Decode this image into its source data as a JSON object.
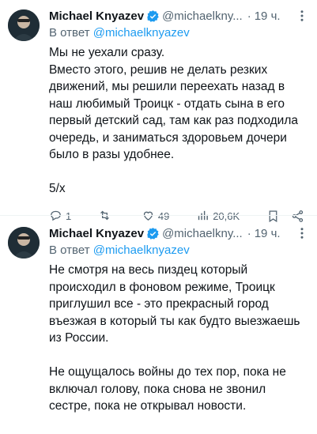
{
  "tweets": [
    {
      "author": "Michael Knyazev",
      "handle": "@michaelkny...",
      "dot": "·",
      "time": "19 ч.",
      "reply_prefix": "В ответ",
      "reply_mention": "@michaelknyazev",
      "paragraphs": [
        "Мы не уехали сразу.\nВместо этого, решив не делать резких движений, мы решили переехать назад в наш любимый Троицк - отдать сына в его первый детский сад, там как раз подходила очередь, и заниматься здоровьем дочери было в разы удобнее.",
        "5/х"
      ],
      "stats": {
        "replies": "1",
        "retweets": "",
        "likes": "49",
        "views": "20,6K"
      }
    },
    {
      "author": "Michael Knyazev",
      "handle": "@michaelkny...",
      "dot": "·",
      "time": "19 ч.",
      "reply_prefix": "В ответ",
      "reply_mention": "@michaelknyazev",
      "paragraphs": [
        "Не смотря на весь пиздец который происходил в фоновом режиме, Троицк приглушил все - это прекрасный город въезжая в который ты как будто выезжаешь из России.",
        "Не ощущалось войны до тех пор, пока не включал голову, пока снова не звонил сестре, пока не открывал новости."
      ]
    }
  ],
  "colors": {
    "accent": "#1d9bf0",
    "muted": "#536471",
    "text": "#0f1419",
    "divider": "#eff3f4"
  },
  "icons": [
    "avatar",
    "verified-badge-icon",
    "more-dots-icon",
    "reply-icon",
    "retweet-icon",
    "like-icon",
    "views-icon",
    "bookmark-icon",
    "share-icon"
  ]
}
